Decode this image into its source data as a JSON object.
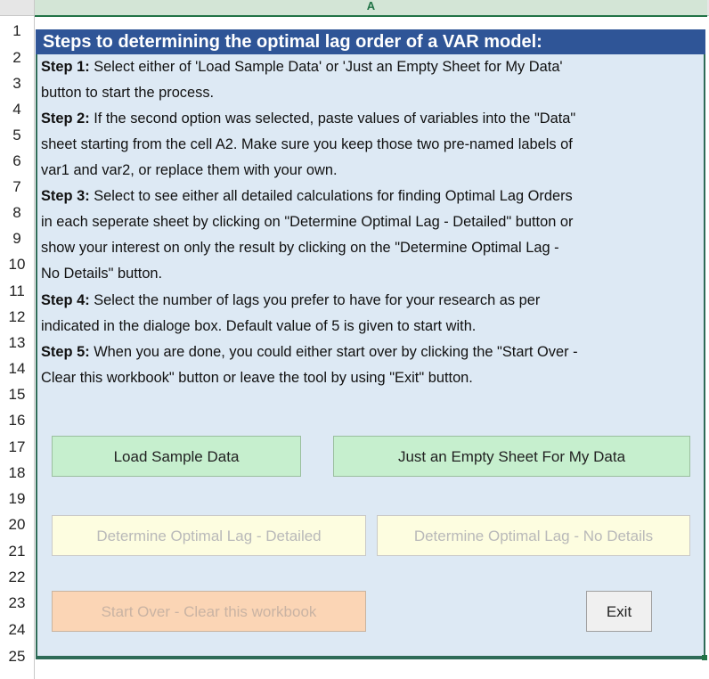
{
  "sheet": {
    "column_label": "A",
    "row_numbers": [
      "1",
      "2",
      "3",
      "4",
      "5",
      "6",
      "7",
      "8",
      "9",
      "10",
      "11",
      "12",
      "13",
      "14",
      "15",
      "16",
      "17",
      "18",
      "19",
      "20",
      "21",
      "22",
      "23",
      "24",
      "25"
    ]
  },
  "panel": {
    "title": "Steps to determining the optimal lag order of a VAR model:",
    "lines": [
      {
        "bold": "Step 1:",
        "text": " Select either of 'Load Sample Data' or 'Just an Empty Sheet for My Data'"
      },
      {
        "bold": "",
        "text": "button to start the process."
      },
      {
        "bold": "Step 2:",
        "text": " If the second option was selected, paste values of variables into the \"Data\""
      },
      {
        "bold": "",
        "text": "sheet starting from the cell A2. Make sure you keep those two pre-named labels of"
      },
      {
        "bold": "",
        "text": "var1 and var2, or replace them with your own."
      },
      {
        "bold": "Step 3:",
        "text": " Select to see either all detailed calculations for finding Optimal Lag Orders"
      },
      {
        "bold": "",
        "text": "in each seperate sheet by clicking on \"Determine Optimal Lag - Detailed\" button or"
      },
      {
        "bold": "",
        "text": "show your interest on only the result by clicking on the \"Determine Optimal Lag -"
      },
      {
        "bold": "",
        "text": "No Details\" button."
      },
      {
        "bold": "Step 4:",
        "text": " Select the number of lags you prefer to have for your research as per"
      },
      {
        "bold": "",
        "text": "indicated in the dialoge box. Default value of 5 is given to start with."
      },
      {
        "bold": "Step 5:",
        "text": " When you are done, you could either start over by clicking the \"Start Over -"
      },
      {
        "bold": "",
        "text": "Clear this workbook\" button or leave the tool by using \"Exit\" button."
      }
    ]
  },
  "buttons": {
    "load_sample": "Load Sample Data",
    "empty_sheet": "Just an Empty Sheet For My Data",
    "optimal_detailed": "Determine Optimal Lag - Detailed",
    "optimal_no_details": "Determine Optimal Lag - No Details",
    "start_over": "Start Over - Clear this workbook",
    "exit": "Exit"
  }
}
